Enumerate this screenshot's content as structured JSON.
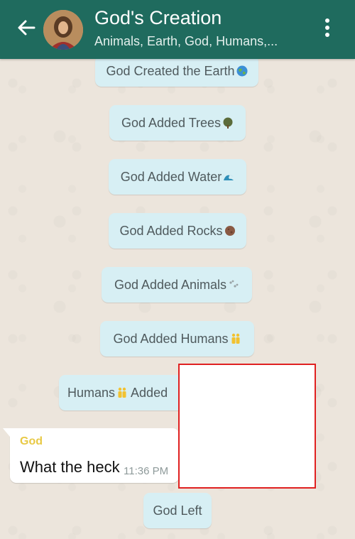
{
  "header": {
    "title": "God's Creation",
    "subtitle": "Animals, Earth, God, Humans,...",
    "color": "#1f6b5e"
  },
  "notices": [
    {
      "text": "God Created the Earth",
      "emoji": "globe-emoji"
    },
    {
      "text": "God Added Trees",
      "emoji": "tree-emoji"
    },
    {
      "text": "God Added Water",
      "emoji": "wave-emoji"
    },
    {
      "text": "God Added Rocks",
      "emoji": "rock-emoji"
    },
    {
      "text": "God Added Animals",
      "emoji": "paw-prints-emoji"
    },
    {
      "text": "God Added Humans",
      "emoji": "people-emoji"
    },
    {
      "text_before": "Humans",
      "text_after": " Added",
      "emoji": "people-emoji"
    },
    {
      "text": "God Left"
    }
  ],
  "message": {
    "sender": "God",
    "text": "What the heck",
    "time": "11:36 PM",
    "sender_color": "#e8c945"
  },
  "redaction_color": "#e02020"
}
